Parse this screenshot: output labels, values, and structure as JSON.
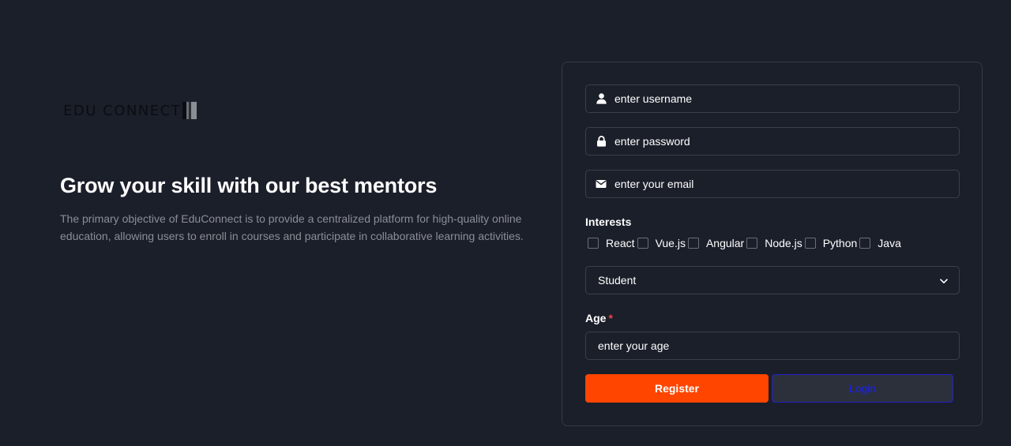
{
  "brand": {
    "logo_text": "EDU CONNECT"
  },
  "hero": {
    "title": "Grow your skill with our best mentors",
    "description": "The primary objective of EduConnect is to provide a centralized platform for high-quality online education, allowing users to enroll in courses and participate in collaborative learning activities."
  },
  "form": {
    "username": {
      "placeholder": "enter username",
      "icon": "user-icon"
    },
    "password": {
      "placeholder": "enter password",
      "icon": "lock-icon"
    },
    "email": {
      "placeholder": "enter your email",
      "icon": "envelope-icon"
    },
    "interests_label": "Interests",
    "interests": [
      {
        "label": "React",
        "checked": false
      },
      {
        "label": "Vue.js",
        "checked": false
      },
      {
        "label": "Angular",
        "checked": false
      },
      {
        "label": "Node.js",
        "checked": false
      },
      {
        "label": "Python",
        "checked": false
      },
      {
        "label": "Java",
        "checked": false
      }
    ],
    "role_select": {
      "value": "Student",
      "icon": "chevron-down-icon"
    },
    "age_label": "Age",
    "age_required_mark": "*",
    "age": {
      "placeholder": "enter your age"
    },
    "register_label": "Register",
    "login_label": "Login"
  },
  "colors": {
    "background": "#1b1f2a",
    "register_button": "#ff4500",
    "login_text": "#1d22e6",
    "required": "#ef4444"
  }
}
